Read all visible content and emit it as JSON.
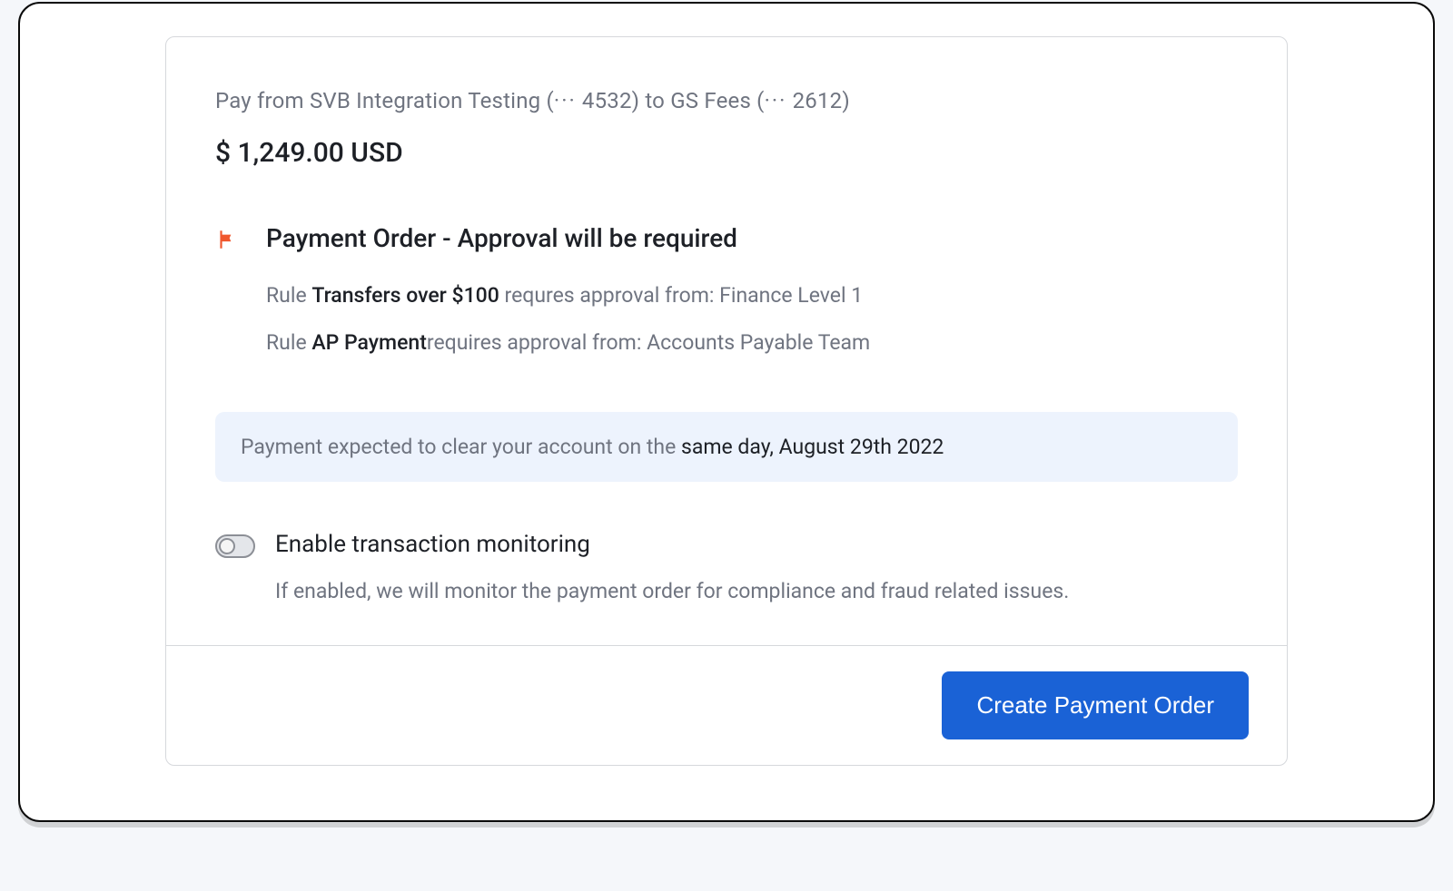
{
  "summary": {
    "pay_from_prefix": "Pay from ",
    "from_account": "SVB Integration Testing",
    "from_mask_prefix": " (",
    "from_mask_dots": "···",
    "from_mask_number": " 4532)",
    "to_prefix": " to ",
    "to_account": "GS Fees",
    "to_mask_prefix": " (",
    "to_mask_dots": "···",
    "to_mask_number": " 2612)",
    "amount": "$ 1,249.00 USD"
  },
  "approval": {
    "title": "Payment Order - Approval will be required",
    "rules": [
      {
        "prefix": "Rule ",
        "name": "Transfers over $100",
        "suffix": " requres approval from: Finance Level 1"
      },
      {
        "prefix": "Rule ",
        "name": "AP Payment",
        "suffix": "requires approval from: Accounts Payable Team"
      }
    ]
  },
  "expected": {
    "prefix": "Payment expected to clear your account on the ",
    "bold": "same day, August 29th 2022"
  },
  "monitoring": {
    "title": "Enable transaction monitoring",
    "description": "If enabled, we will monitor the payment order for compliance and fraud related issues.",
    "enabled": false
  },
  "footer": {
    "create_label": "Create Payment Order"
  }
}
